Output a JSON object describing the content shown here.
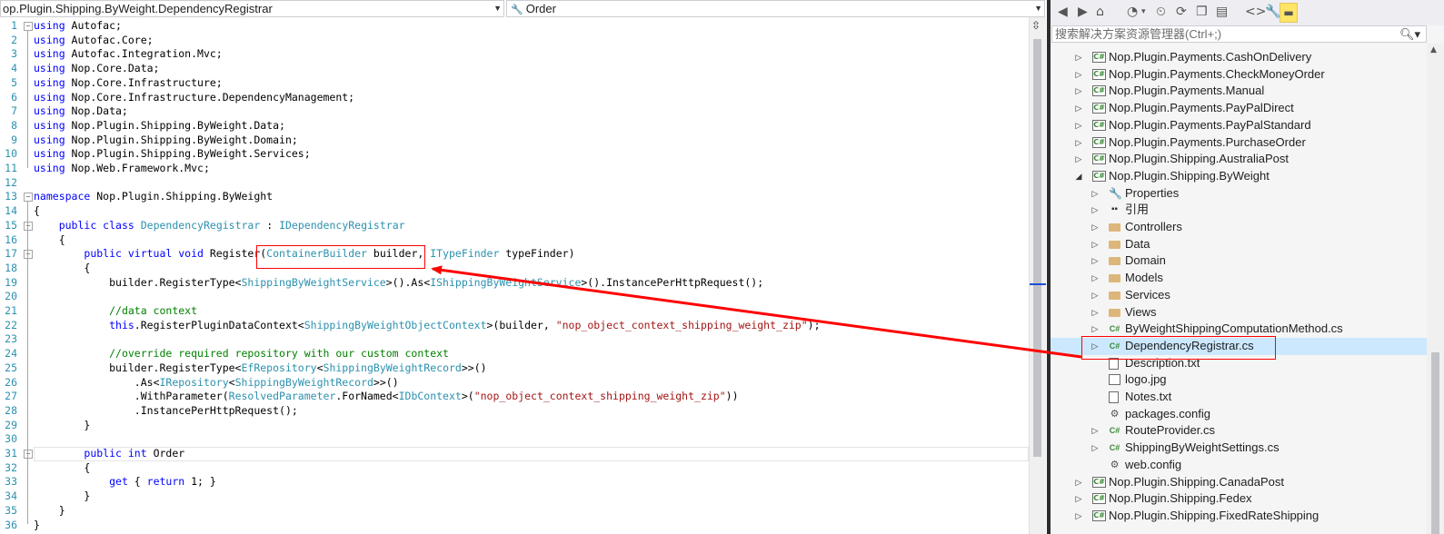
{
  "editor": {
    "class_dropdown": "op.Plugin.Shipping.ByWeight.DependencyRegistrar",
    "member_dropdown": "Order",
    "lines": [
      {
        "n": "1",
        "tokens": [
          {
            "c": "kw",
            "t": "using"
          },
          {
            "c": "",
            "t": " Autofac;"
          }
        ]
      },
      {
        "n": "2",
        "tokens": [
          {
            "c": "kw",
            "t": "using"
          },
          {
            "c": "",
            "t": " Autofac.Core;"
          }
        ]
      },
      {
        "n": "3",
        "tokens": [
          {
            "c": "kw",
            "t": "using"
          },
          {
            "c": "",
            "t": " Autofac.Integration.Mvc;"
          }
        ]
      },
      {
        "n": "4",
        "tokens": [
          {
            "c": "kw",
            "t": "using"
          },
          {
            "c": "",
            "t": " Nop.Core.Data;"
          }
        ]
      },
      {
        "n": "5",
        "tokens": [
          {
            "c": "kw",
            "t": "using"
          },
          {
            "c": "",
            "t": " Nop.Core.Infrastructure;"
          }
        ]
      },
      {
        "n": "6",
        "tokens": [
          {
            "c": "kw",
            "t": "using"
          },
          {
            "c": "",
            "t": " Nop.Core.Infrastructure.DependencyManagement;"
          }
        ]
      },
      {
        "n": "7",
        "tokens": [
          {
            "c": "kw",
            "t": "using"
          },
          {
            "c": "",
            "t": " Nop.Data;"
          }
        ]
      },
      {
        "n": "8",
        "tokens": [
          {
            "c": "kw",
            "t": "using"
          },
          {
            "c": "",
            "t": " Nop.Plugin.Shipping.ByWeight.Data;"
          }
        ]
      },
      {
        "n": "9",
        "tokens": [
          {
            "c": "kw",
            "t": "using"
          },
          {
            "c": "",
            "t": " Nop.Plugin.Shipping.ByWeight.Domain;"
          }
        ]
      },
      {
        "n": "10",
        "tokens": [
          {
            "c": "kw",
            "t": "using"
          },
          {
            "c": "",
            "t": " Nop.Plugin.Shipping.ByWeight.Services;"
          }
        ]
      },
      {
        "n": "11",
        "tokens": [
          {
            "c": "kw",
            "t": "using"
          },
          {
            "c": "",
            "t": " Nop.Web.Framework.Mvc;"
          }
        ]
      },
      {
        "n": "12",
        "tokens": []
      },
      {
        "n": "13",
        "tokens": [
          {
            "c": "kw",
            "t": "namespace"
          },
          {
            "c": "",
            "t": " Nop.Plugin.Shipping.ByWeight"
          }
        ]
      },
      {
        "n": "14",
        "tokens": [
          {
            "c": "",
            "t": "{"
          }
        ]
      },
      {
        "n": "15",
        "tokens": [
          {
            "c": "",
            "t": "    "
          },
          {
            "c": "kw",
            "t": "public class"
          },
          {
            "c": "",
            "t": " "
          },
          {
            "c": "ty",
            "t": "DependencyRegistrar"
          },
          {
            "c": "",
            "t": " : "
          },
          {
            "c": "ty",
            "t": "IDependencyRegistrar"
          }
        ]
      },
      {
        "n": "16",
        "tokens": [
          {
            "c": "",
            "t": "    {"
          }
        ]
      },
      {
        "n": "17",
        "tokens": [
          {
            "c": "",
            "t": "        "
          },
          {
            "c": "kw",
            "t": "public virtual void"
          },
          {
            "c": "",
            "t": " Register("
          },
          {
            "c": "ty",
            "t": "ContainerBuilder"
          },
          {
            "c": "",
            "t": " builder, "
          },
          {
            "c": "ty",
            "t": "ITypeFinder"
          },
          {
            "c": "",
            "t": " typeFinder)"
          }
        ]
      },
      {
        "n": "18",
        "tokens": [
          {
            "c": "",
            "t": "        {"
          }
        ]
      },
      {
        "n": "19",
        "tokens": [
          {
            "c": "",
            "t": "            builder.RegisterType<"
          },
          {
            "c": "ty",
            "t": "ShippingByWeightService"
          },
          {
            "c": "",
            "t": ">().As<"
          },
          {
            "c": "ty",
            "t": "IShippingByWeightService"
          },
          {
            "c": "",
            "t": ">().InstancePerHttpRequest();"
          }
        ]
      },
      {
        "n": "20",
        "tokens": []
      },
      {
        "n": "21",
        "tokens": [
          {
            "c": "",
            "t": "            "
          },
          {
            "c": "cm",
            "t": "//data context"
          }
        ]
      },
      {
        "n": "22",
        "tokens": [
          {
            "c": "",
            "t": "            "
          },
          {
            "c": "kw",
            "t": "this"
          },
          {
            "c": "",
            "t": ".RegisterPluginDataContext<"
          },
          {
            "c": "ty",
            "t": "ShippingByWeightObjectContext"
          },
          {
            "c": "",
            "t": ">(builder, "
          },
          {
            "c": "st",
            "t": "\"nop_object_context_shipping_weight_zip\""
          },
          {
            "c": "",
            "t": ");"
          }
        ]
      },
      {
        "n": "23",
        "tokens": []
      },
      {
        "n": "24",
        "tokens": [
          {
            "c": "",
            "t": "            "
          },
          {
            "c": "cm",
            "t": "//override required repository with our custom context"
          }
        ]
      },
      {
        "n": "25",
        "tokens": [
          {
            "c": "",
            "t": "            builder.RegisterType<"
          },
          {
            "c": "ty",
            "t": "EfRepository"
          },
          {
            "c": "",
            "t": "<"
          },
          {
            "c": "ty",
            "t": "ShippingByWeightRecord"
          },
          {
            "c": "",
            "t": ">>()"
          }
        ]
      },
      {
        "n": "26",
        "tokens": [
          {
            "c": "",
            "t": "                .As<"
          },
          {
            "c": "ty",
            "t": "IRepository"
          },
          {
            "c": "",
            "t": "<"
          },
          {
            "c": "ty",
            "t": "ShippingByWeightRecord"
          },
          {
            "c": "",
            "t": ">>()"
          }
        ]
      },
      {
        "n": "27",
        "tokens": [
          {
            "c": "",
            "t": "                .WithParameter("
          },
          {
            "c": "ty",
            "t": "ResolvedParameter"
          },
          {
            "c": "",
            "t": ".ForNamed<"
          },
          {
            "c": "ty",
            "t": "IDbContext"
          },
          {
            "c": "",
            "t": ">("
          },
          {
            "c": "st",
            "t": "\"nop_object_context_shipping_weight_zip\""
          },
          {
            "c": "",
            "t": "))"
          }
        ]
      },
      {
        "n": "28",
        "tokens": [
          {
            "c": "",
            "t": "                .InstancePerHttpRequest();"
          }
        ]
      },
      {
        "n": "29",
        "tokens": [
          {
            "c": "",
            "t": "        }"
          }
        ]
      },
      {
        "n": "30",
        "tokens": []
      },
      {
        "n": "31",
        "tokens": [
          {
            "c": "",
            "t": "        "
          },
          {
            "c": "kw",
            "t": "public int"
          },
          {
            "c": "",
            "t": " Order"
          }
        ]
      },
      {
        "n": "32",
        "tokens": [
          {
            "c": "",
            "t": "        {"
          }
        ]
      },
      {
        "n": "33",
        "tokens": [
          {
            "c": "",
            "t": "            "
          },
          {
            "c": "kw",
            "t": "get"
          },
          {
            "c": "",
            "t": " { "
          },
          {
            "c": "kw",
            "t": "return"
          },
          {
            "c": "",
            "t": " 1; }"
          }
        ]
      },
      {
        "n": "34",
        "tokens": [
          {
            "c": "",
            "t": "        }"
          }
        ]
      },
      {
        "n": "35",
        "tokens": [
          {
            "c": "",
            "t": "    }"
          }
        ]
      },
      {
        "n": "36",
        "tokens": [
          {
            "c": "",
            "t": "}"
          }
        ]
      }
    ]
  },
  "solution_explorer": {
    "search_placeholder": "搜索解决方案资源管理器(Ctrl+;)",
    "items": [
      {
        "label": "Nop.Plugin.Payments.CashOnDelivery",
        "icon": "cs",
        "expand": "collapsed",
        "indent": 0
      },
      {
        "label": "Nop.Plugin.Payments.CheckMoneyOrder",
        "icon": "cs",
        "expand": "collapsed",
        "indent": 0
      },
      {
        "label": "Nop.Plugin.Payments.Manual",
        "icon": "cs",
        "expand": "collapsed",
        "indent": 0
      },
      {
        "label": "Nop.Plugin.Payments.PayPalDirect",
        "icon": "cs",
        "expand": "collapsed",
        "indent": 0
      },
      {
        "label": "Nop.Plugin.Payments.PayPalStandard",
        "icon": "cs",
        "expand": "collapsed",
        "indent": 0
      },
      {
        "label": "Nop.Plugin.Payments.PurchaseOrder",
        "icon": "cs",
        "expand": "collapsed",
        "indent": 0
      },
      {
        "label": "Nop.Plugin.Shipping.AustraliaPost",
        "icon": "cs",
        "expand": "collapsed",
        "indent": 0
      },
      {
        "label": "Nop.Plugin.Shipping.ByWeight",
        "icon": "cs",
        "expand": "expanded",
        "indent": 0
      },
      {
        "label": "Properties",
        "icon": "wrench",
        "expand": "collapsed",
        "indent": 1
      },
      {
        "label": "引用",
        "icon": "ref",
        "expand": "collapsed",
        "indent": 1
      },
      {
        "label": "Controllers",
        "icon": "folder",
        "expand": "collapsed",
        "indent": 1
      },
      {
        "label": "Data",
        "icon": "folder",
        "expand": "collapsed",
        "indent": 1
      },
      {
        "label": "Domain",
        "icon": "folder",
        "expand": "collapsed",
        "indent": 1
      },
      {
        "label": "Models",
        "icon": "folder",
        "expand": "collapsed",
        "indent": 1
      },
      {
        "label": "Services",
        "icon": "folder",
        "expand": "collapsed",
        "indent": 1
      },
      {
        "label": "Views",
        "icon": "folder",
        "expand": "collapsed",
        "indent": 1
      },
      {
        "label": "ByWeightShippingComputationMethod.cs",
        "icon": "csfile",
        "expand": "collapsed",
        "indent": 1
      },
      {
        "label": "DependencyRegistrar.cs",
        "icon": "csfile",
        "expand": "collapsed",
        "indent": 1,
        "selected": true
      },
      {
        "label": "Description.txt",
        "icon": "page",
        "expand": "none",
        "indent": 1
      },
      {
        "label": "logo.jpg",
        "icon": "img",
        "expand": "none",
        "indent": 1
      },
      {
        "label": "Notes.txt",
        "icon": "page",
        "expand": "none",
        "indent": 1
      },
      {
        "label": "packages.config",
        "icon": "cfg",
        "expand": "none",
        "indent": 1
      },
      {
        "label": "RouteProvider.cs",
        "icon": "csfile",
        "expand": "collapsed",
        "indent": 1
      },
      {
        "label": "ShippingByWeightSettings.cs",
        "icon": "csfile",
        "expand": "collapsed",
        "indent": 1
      },
      {
        "label": "web.config",
        "icon": "cfg",
        "expand": "none",
        "indent": 1
      },
      {
        "label": "Nop.Plugin.Shipping.CanadaPost",
        "icon": "cs",
        "expand": "collapsed",
        "indent": 0
      },
      {
        "label": "Nop.Plugin.Shipping.Fedex",
        "icon": "cs",
        "expand": "collapsed",
        "indent": 0
      },
      {
        "label": "Nop.Plugin.Shipping.FixedRateShipping",
        "icon": "cs",
        "expand": "collapsed",
        "indent": 0
      }
    ]
  },
  "colors": {
    "keyword": "#0000ff",
    "type": "#2b91af",
    "comment": "#008000",
    "string": "#a31515",
    "annotation": "#ff0000",
    "selection": "#cce8ff"
  }
}
